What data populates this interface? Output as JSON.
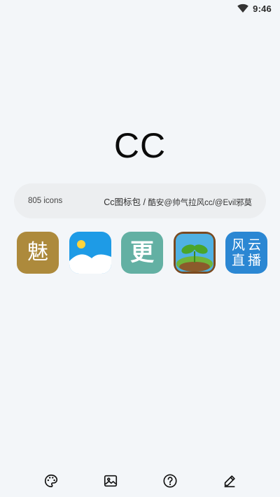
{
  "status_bar": {
    "time": "9:46",
    "wifi_icon": "wifi-icon"
  },
  "title": "CC",
  "info": {
    "icon_count": "805 icons",
    "pack_name": "Cc图标包 / ",
    "authors": "酷安@帅气拉风cc/@Evil邪莫"
  },
  "icons": [
    {
      "name": "mei-calligraphy-app-icon",
      "glyph": "魅",
      "color": "#ad8a3c"
    },
    {
      "name": "gallery-app-icon",
      "color": "#1e9be6"
    },
    {
      "name": "geng-app-icon",
      "glyph": "更",
      "color": "#63b0a3"
    },
    {
      "name": "sprout-game-app-icon",
      "color": "#5a9b2e"
    },
    {
      "name": "fengyun-live-app-icon",
      "glyph_chars": [
        "风",
        "云",
        "直",
        "播"
      ],
      "color": "#2b87d3"
    }
  ],
  "bottom_nav": [
    "palette-icon",
    "image-icon",
    "help-icon",
    "edit-icon"
  ]
}
